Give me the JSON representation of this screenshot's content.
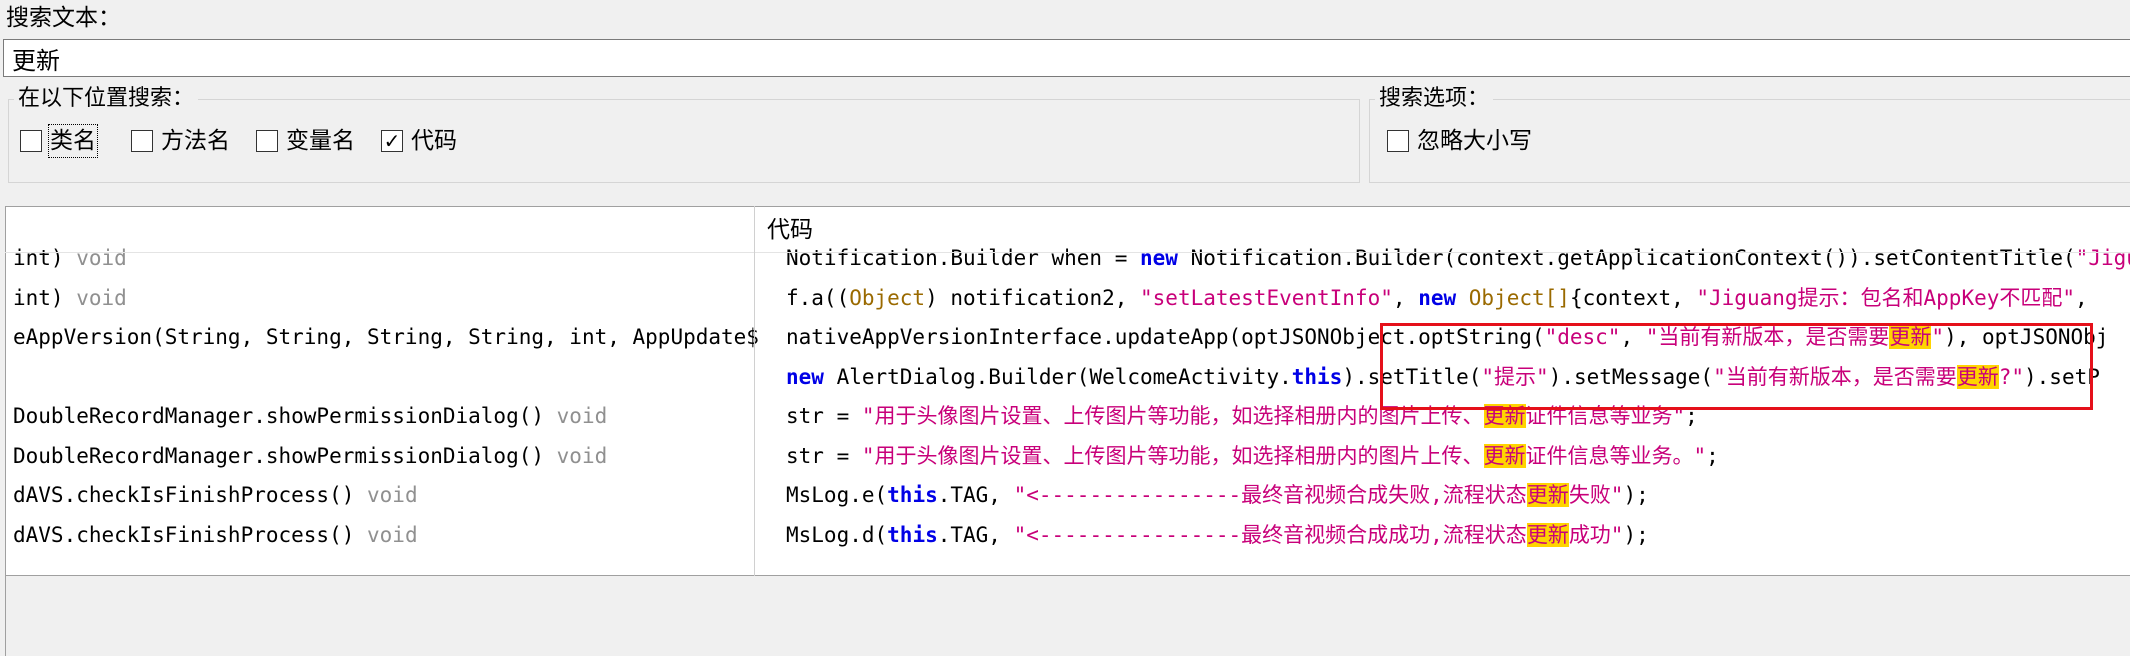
{
  "search": {
    "label": "搜索文本：",
    "value": "更新"
  },
  "location_group": {
    "title": "在以下位置搜索：",
    "options": [
      {
        "label": "类名",
        "checked": false
      },
      {
        "label": "方法名",
        "checked": false
      },
      {
        "label": "变量名",
        "checked": false
      },
      {
        "label": "代码",
        "checked": true
      }
    ]
  },
  "options_group": {
    "title": "搜索选项：",
    "options": [
      {
        "label": "忽略大小写",
        "checked": false
      }
    ]
  },
  "results": {
    "code_header": "代码",
    "rows": [
      {
        "node": [
          {
            "t": "int) "
          },
          {
            "t": "void",
            "c": "void"
          }
        ],
        "code": [
          {
            "t": "Notification.Builder when = "
          },
          {
            "t": "new",
            "c": "kw"
          },
          {
            "t": " Notification.Builder"
          },
          {
            "t": "("
          },
          {
            "t": "context.getApplicationContext"
          },
          {
            "t": "()"
          },
          {
            "t": ")"
          },
          {
            "t": ".setContentTitle("
          },
          {
            "t": "\"Jiguang\"",
            "c": "str"
          }
        ]
      },
      {
        "node": [
          {
            "t": "int) "
          },
          {
            "t": "void",
            "c": "void"
          }
        ],
        "code": [
          {
            "t": "f.a(("
          },
          {
            "t": "Object",
            "c": "ty"
          },
          {
            "t": ") notification2, "
          },
          {
            "t": "\"setLatestEventInfo\"",
            "c": "str"
          },
          {
            "t": ", "
          },
          {
            "t": "new",
            "c": "kw"
          },
          {
            "t": " "
          },
          {
            "t": "Object[]",
            "c": "ty"
          },
          {
            "t": "{context, "
          },
          {
            "t": "\"Jiguang提示：包名和AppKey不匹配\"",
            "c": "str"
          },
          {
            "t": ", "
          }
        ]
      },
      {
        "node": [
          {
            "t": "eAppVersion(String, String, String, String, int, AppUpdate$"
          }
        ],
        "code": [
          {
            "t": "nativeAppVersionInterface.updateApp(optJSONObject.optString("
          },
          {
            "t": "\"desc\"",
            "c": "str"
          },
          {
            "t": ", "
          },
          {
            "t": "\"当前有新版本，是否需要",
            "c": "str"
          },
          {
            "t": "更新",
            "c": "hl"
          },
          {
            "t": "\"",
            "c": "str"
          },
          {
            "t": "), optJSONObj"
          }
        ]
      },
      {
        "node": [],
        "code": [
          {
            "t": "new",
            "c": "kw"
          },
          {
            "t": " AlertDialog.Builder(WelcomeActivity."
          },
          {
            "t": "this",
            "c": "kw"
          },
          {
            "t": ").setTitle("
          },
          {
            "t": "\"提示\"",
            "c": "str"
          },
          {
            "t": ").setMessage("
          },
          {
            "t": "\"当前有新版本，是否需要",
            "c": "str"
          },
          {
            "t": "更新",
            "c": "hl"
          },
          {
            "t": "?\"",
            "c": "str"
          },
          {
            "t": ").setP"
          }
        ]
      },
      {
        "node": [
          {
            "t": "DoubleRecordManager.showPermissionDialog() "
          },
          {
            "t": "void",
            "c": "void"
          }
        ],
        "code": [
          {
            "t": "str = "
          },
          {
            "t": "\"用于头像图片设置、上传图片等功能，如选择相册内的图片上传、",
            "c": "str"
          },
          {
            "t": "更新",
            "c": "hl"
          },
          {
            "t": "证件信息等业务\"",
            "c": "str"
          },
          {
            "t": ";"
          }
        ]
      },
      {
        "node": [
          {
            "t": "DoubleRecordManager.showPermissionDialog() "
          },
          {
            "t": "void",
            "c": "void"
          }
        ],
        "code": [
          {
            "t": "str = "
          },
          {
            "t": "\"用于头像图片设置、上传图片等功能，如选择相册内的图片上传、",
            "c": "str"
          },
          {
            "t": "更新",
            "c": "hl"
          },
          {
            "t": "证件信息等业务。\"",
            "c": "str"
          },
          {
            "t": ";"
          }
        ]
      },
      {
        "node": [
          {
            "t": "dAVS.checkIsFinishProcess() "
          },
          {
            "t": "void",
            "c": "void"
          }
        ],
        "code": [
          {
            "t": "MsLog.e("
          },
          {
            "t": "this",
            "c": "kw"
          },
          {
            "t": ".TAG, "
          },
          {
            "t": "\"<----------------最终音视频合成失败,流程状态",
            "c": "str"
          },
          {
            "t": "更新",
            "c": "hl"
          },
          {
            "t": "失败\"",
            "c": "str"
          },
          {
            "t": ");"
          }
        ]
      },
      {
        "node": [
          {
            "t": "dAVS.checkIsFinishProcess() "
          },
          {
            "t": "void",
            "c": "void"
          }
        ],
        "code": [
          {
            "t": "MsLog.d("
          },
          {
            "t": "this",
            "c": "kw"
          },
          {
            "t": ".TAG, "
          },
          {
            "t": "\"<----------------最终音视频合成成功,流程状态",
            "c": "str"
          },
          {
            "t": "更新",
            "c": "hl"
          },
          {
            "t": "成功\"",
            "c": "str"
          },
          {
            "t": ");"
          }
        ]
      }
    ]
  },
  "colors": {
    "keyword": "#0000e6",
    "string": "#c8007a",
    "highlight": "#ffd400",
    "annotation": "#e5101a"
  }
}
